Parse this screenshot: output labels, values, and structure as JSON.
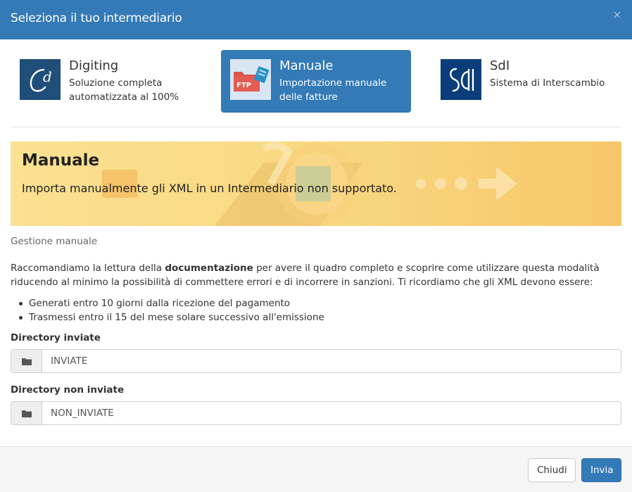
{
  "modal": {
    "title": "Seleziona il tuo intermediario",
    "close_symbol": "×"
  },
  "intermediaries": [
    {
      "name": "Digiting",
      "line1": "Soluzione completa",
      "line2": "automatizzata al 100%",
      "icon": "digiting-logo",
      "active": false
    },
    {
      "name": "Manuale",
      "line1": "Importazione manuale",
      "line2": "delle fatture",
      "icon": "ftp-xml-icon",
      "active": true,
      "logo_text": "FTP"
    },
    {
      "name": "SdI",
      "line1": "Sistema di Interscambio",
      "line2": "",
      "icon": "sdi-logo",
      "active": false
    }
  ],
  "banner": {
    "title": "Manuale",
    "subtitle": "Importa manualmente gli XML in un Intermediario non supportato."
  },
  "section_label": "Gestione manuale",
  "paragraph": {
    "before": "Raccomandiamo la lettura della ",
    "link": "documentazione",
    "after": " per avere il quadro completo e scoprire come utilizzare questa modalità riducendo al minimo la possibilità di commettere errori e di incorrere in sanzioni. Ti ricordiamo che gli XML devono essere:"
  },
  "bullets": [
    "Generati entro 10 giorni dalla ricezione del pagamento",
    "Trasmessi entro il 15 del mese solare successivo all'emissione"
  ],
  "fields": {
    "sent": {
      "label": "Directory inviate",
      "value": "INVIATE"
    },
    "unsent": {
      "label": "Directory non inviate",
      "value": "NON_INVIATE"
    }
  },
  "footer": {
    "close_label": "Chiudi",
    "submit_label": "Invia"
  },
  "colors": {
    "primary": "#337ab7",
    "banner": "#f9d880"
  }
}
